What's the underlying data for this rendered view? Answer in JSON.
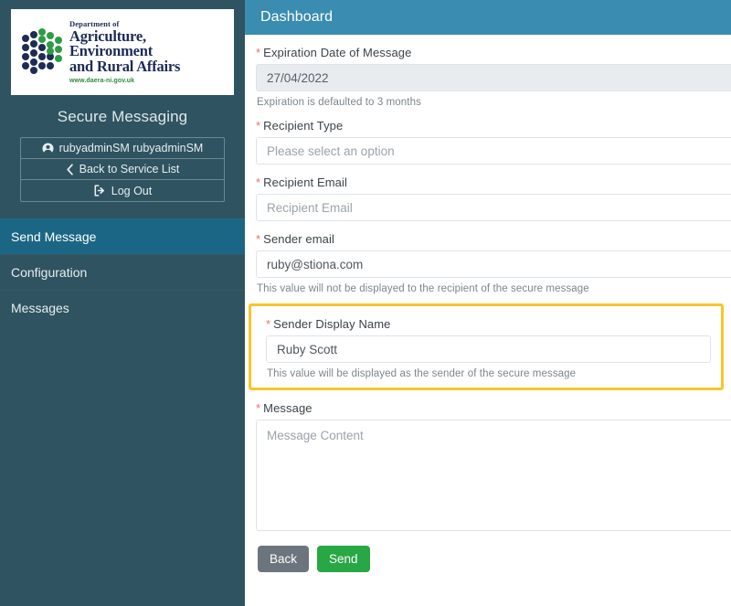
{
  "sidebar": {
    "logo": {
      "department_line": "Department of",
      "main_line_1": "Agriculture, Environment",
      "main_line_2": "and Rural Affairs",
      "url": "www.daera-ni.gov.uk",
      "navy": "#1d2b55",
      "green": "#2e8b3f"
    },
    "app_title": "Secure Messaging",
    "account": [
      {
        "label": "rubyadminSM rubyadminSM",
        "icon": "user-circle-icon"
      },
      {
        "label": "Back to Service List",
        "icon": "chevron-left-icon"
      },
      {
        "label": "Log Out",
        "icon": "sign-out-icon"
      }
    ],
    "nav": [
      {
        "label": "Send Message",
        "active": true
      },
      {
        "label": "Configuration",
        "active": false
      },
      {
        "label": "Messages",
        "active": false
      }
    ],
    "background_color": "#2f5360",
    "active_color": "#1b6685"
  },
  "header": {
    "title": "Dashboard",
    "background_color": "#3a8cb0"
  },
  "form": {
    "required_marker": "*",
    "expiration": {
      "label": "Expiration Date of Message",
      "value": "27/04/2022",
      "helper": "Expiration is defaulted to 3 months"
    },
    "recipient_type": {
      "label": "Recipient Type",
      "value": "Please select an option"
    },
    "recipient_email": {
      "label": "Recipient Email",
      "placeholder": "Recipient Email"
    },
    "sender_email": {
      "label": "Sender email",
      "value": "ruby@stiona.com",
      "helper": "This value will not be displayed to the recipient of the secure message"
    },
    "sender_display_name": {
      "label": "Sender Display Name",
      "value": "Ruby Scott",
      "helper": "This value will be displayed as the sender of the secure message",
      "highlight_color": "#f7c52b"
    },
    "message": {
      "label": "Message",
      "placeholder": "Message Content"
    },
    "buttons": {
      "back": "Back",
      "send": "Send"
    }
  }
}
